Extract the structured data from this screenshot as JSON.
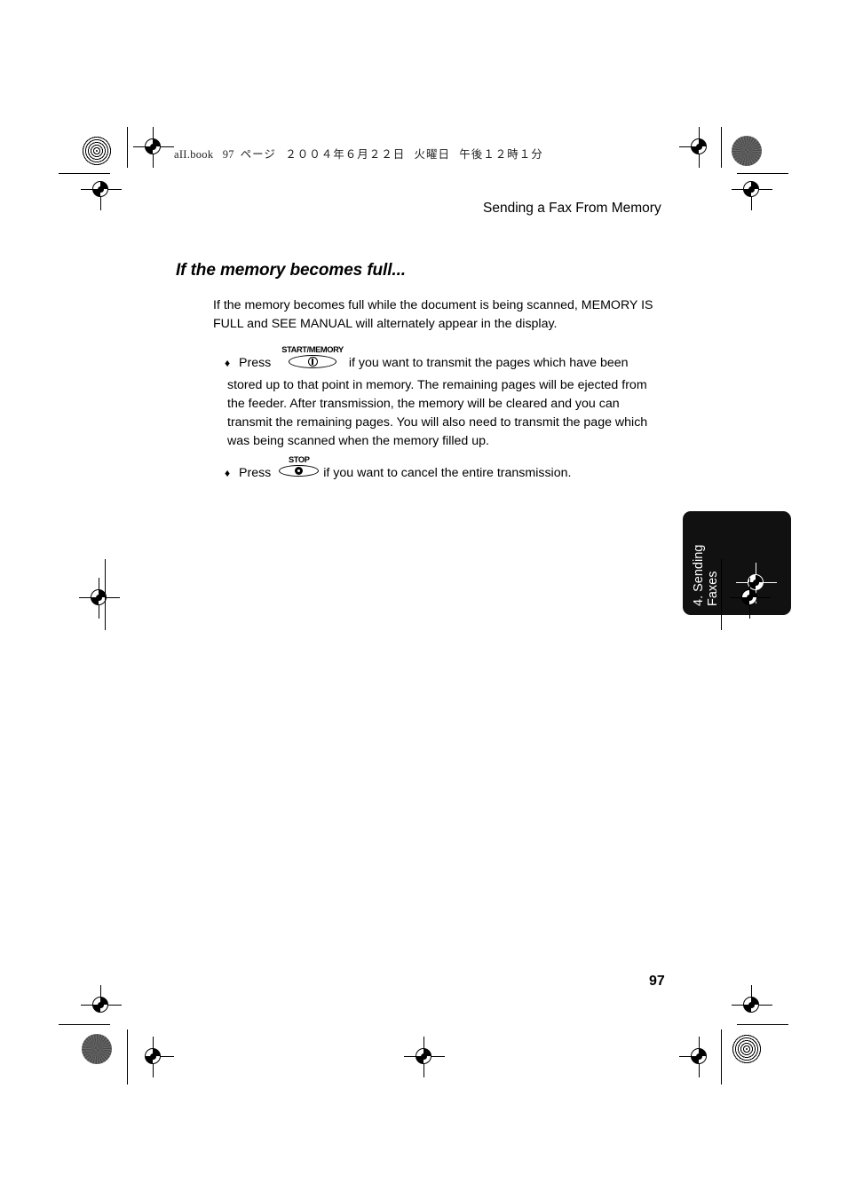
{
  "print_marks": {
    "file_stamp": {
      "filename": "aII.book",
      "page_word": "97",
      "page_unit": "ページ",
      "date": "２００４年６月２２日",
      "weekday": "火曜日",
      "time": "午後１２時１分"
    },
    "registration_icon": "registration-target-icon",
    "halftone_icon": "halftone-density-patch-icon"
  },
  "header": {
    "running_head": "Sending a Fax From Memory"
  },
  "content": {
    "section_heading": "If the memory becomes full...",
    "intro_paragraph": "If the memory becomes full while the document is being scanned, MEMORY IS FULL and SEE MANUAL will alternately appear in the display.",
    "bullets": [
      {
        "marker": "♦",
        "lead": "Press",
        "key": {
          "label": "START/MEMORY",
          "icon": "start-memory-key-icon"
        },
        "tail": "if you want to transmit the pages which have been",
        "continuation": "stored up to that point in memory. The remaining pages will be ejected from the feeder. After transmission, the memory will be cleared and you can transmit the remaining pages. You will also need to transmit the page which was being scanned when the memory filled up."
      },
      {
        "marker": "♦",
        "lead": "Press",
        "key": {
          "label": "STOP",
          "icon": "stop-key-icon"
        },
        "tail": "if you want to cancel the entire transmission.",
        "continuation": ""
      }
    ]
  },
  "side_tab": {
    "chapter_number": "4. Sending",
    "chapter_name": "Faxes",
    "background_color": "#111111",
    "text_color": "#ffffff"
  },
  "footer": {
    "page_number": "97"
  }
}
